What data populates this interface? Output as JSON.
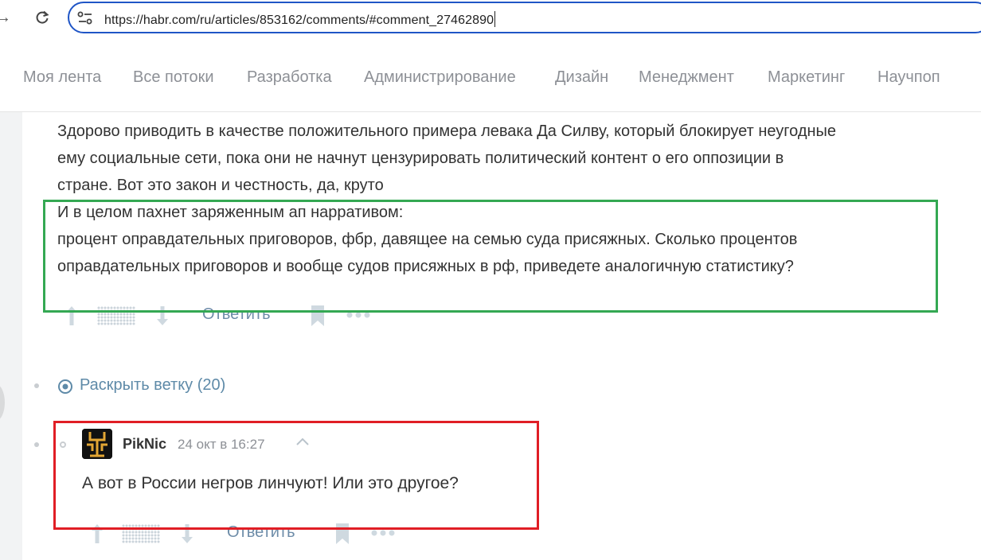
{
  "browser": {
    "url": "https://habr.com/ru/articles/853162/comments/#comment_27462890"
  },
  "nav": {
    "items": [
      "Моя лента",
      "Все потоки",
      "Разработка",
      "Администрирование",
      "Дизайн",
      "Менеджмент",
      "Маркетинг",
      "Научпоп"
    ]
  },
  "comment1": {
    "lines": [
      "Здорово приводить в качестве положительного примера левака Да Силву, который блокирует неугодные",
      "ему социальные сети, пока они не начнут цензурировать политический контент о его оппозиции в",
      "стране. Вот это закон и честность, да, круто",
      "И в целом пахнет заряженным ап нарративом:",
      "процент оправдательных приговоров, фбр, давящее на семью суда присяжных. Сколько процентов",
      "оправдательных приговоров и вообще судов присяжных в рф, приведете аналогичную статистику?"
    ],
    "reply_label": "Ответить"
  },
  "thread": {
    "expand_label": "Раскрыть ветку (20)"
  },
  "comment2": {
    "author": "PikNic",
    "date": "24 окт в 16:27",
    "text": "А вот в России негров линчуют! Или это другое?",
    "reply_label": "Ответить"
  },
  "colors": {
    "highlight_green": "#34a853",
    "highlight_red": "#e01e25",
    "link": "#5e8aa8",
    "url_border": "#1f55c6"
  }
}
